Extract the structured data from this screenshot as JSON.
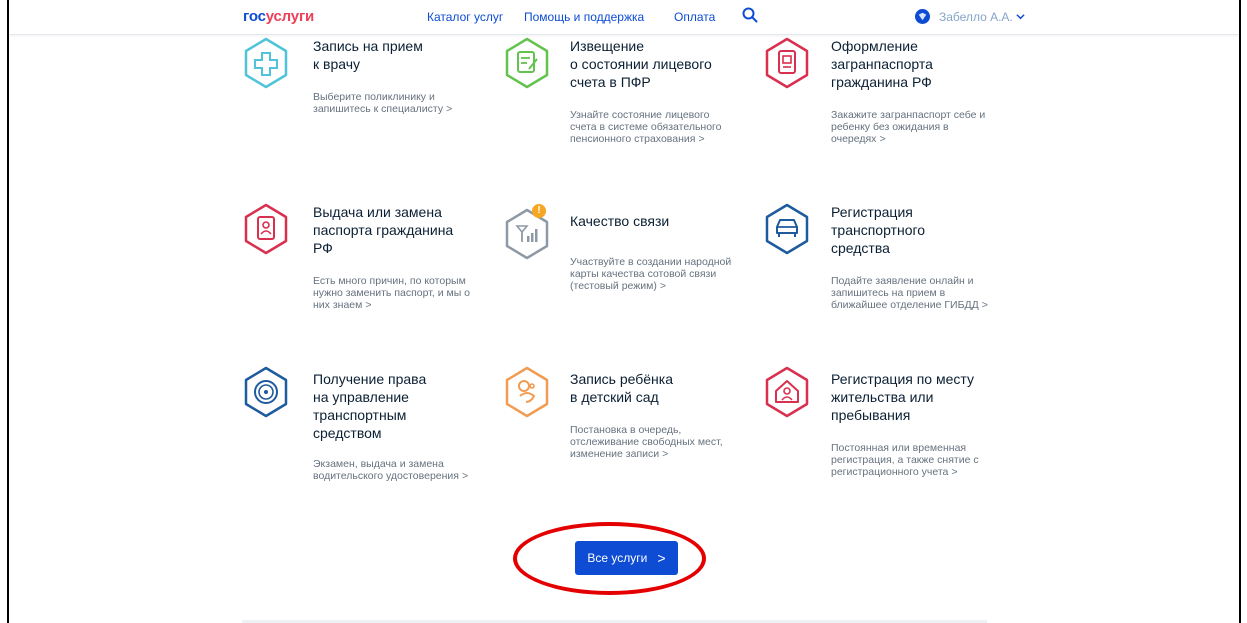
{
  "header": {
    "logo_part1": "гос",
    "logo_part2": "услуги",
    "nav": [
      "Каталог услуг",
      "Помощь и поддержка",
      "Оплата"
    ],
    "user_name": "Забелло А.А."
  },
  "services": [
    {
      "title": "Запись на прием\nк врачу",
      "desc": "Выберите поликлинику и\nзапишитесь к специалисту",
      "icon": "medical-cross-icon"
    },
    {
      "title": "Извещение\nо состоянии лицевого\nсчета в ПФР",
      "desc": "Узнайте состояние лицевого\nсчета в системе обязательного\nпенсионного страхования",
      "icon": "document-edit-icon"
    },
    {
      "title": "Оформление\nзагранпаспорта\nгражданина РФ",
      "desc": "Закажите загранпаспорт себе и\nребенку без ожидания в\nочередях",
      "icon": "passport-icon"
    },
    {
      "title": "Выдача или замена\nпаспорта гражданина\nРФ",
      "desc": "Есть много причин, по которым\nнужно заменить паспорт, и мы о\nних знаем",
      "icon": "passport-person-icon"
    },
    {
      "title": "Качество связи",
      "desc": "Участвуйте в создании народной\nкарты качества сотовой связи\n(тестовый режим)",
      "icon": "signal-icon",
      "badge": "!"
    },
    {
      "title": "Регистрация\nтранспортного\nсредства",
      "desc": "Подайте заявление онлайн и\nзапишитесь на прием в\nближайшее отделение ГИБДД",
      "icon": "car-icon"
    },
    {
      "title": "Получение права\nна управление\nтранспортным\nсредством",
      "desc": "Экзамен, выдача и замена\nводительского удостоверения",
      "icon": "steering-wheel-icon"
    },
    {
      "title": "Запись ребёнка\nв детский сад",
      "desc": "Постановка в очередь,\nотслеживание свободных мест,\nизменение записи",
      "icon": "child-icon"
    },
    {
      "title": "Регистрация по месту\nжительства или\nпребывания",
      "desc": "Постоянная или временная\nрегистрация, а также снятие с\nрегистрационного учета",
      "icon": "house-person-icon"
    }
  ],
  "arrow": ">",
  "all_services_button": "Все услуги",
  "colors": {
    "primary": "#0d4cd3",
    "brand_red": "#ee3f58",
    "cyan": "#4fc3d9",
    "green": "#63c34e",
    "pink": "#d8304e",
    "blue": "#1d5a9e",
    "orange": "#f29b53",
    "annotation": "#e40000"
  }
}
